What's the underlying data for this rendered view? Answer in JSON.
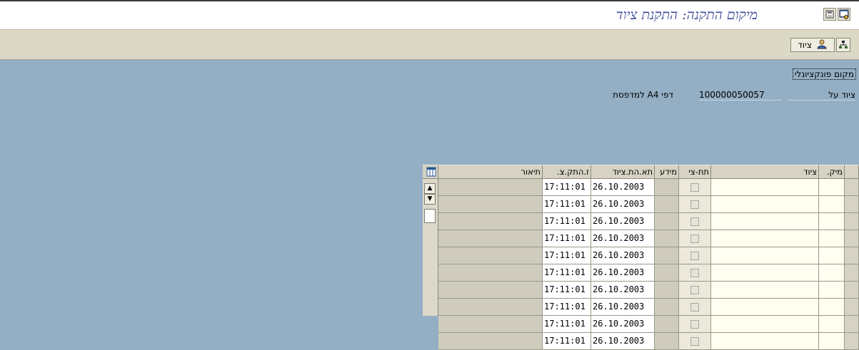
{
  "window": {
    "title": "מיקום התקנה: התקנת ציוד",
    "icons": [
      "save-icon",
      "layout-icon"
    ]
  },
  "toolbar": {
    "equipment_label": "ציוד",
    "icons": [
      "hierarchy-icon",
      "person-icon"
    ]
  },
  "header": {
    "functional_location_label": "מקום פונקציונלי",
    "equipment_on_label": "ציוד על",
    "equipment_number": "100000050057",
    "equipment_description": "דפי A4 למדפסת"
  },
  "table": {
    "columns": {
      "loc": "מיק.",
      "equipment": "ציוד",
      "sub_equipment": "תת-צי",
      "info": "מידע",
      "install_date": "תא.הת.ציוד",
      "install_time": "ז.התק.צ.",
      "description": "תיאור"
    },
    "rows": [
      {
        "date": "26.10.2003",
        "time": "17:11:01"
      },
      {
        "date": "26.10.2003",
        "time": "17:11:01"
      },
      {
        "date": "26.10.2003",
        "time": "17:11:01"
      },
      {
        "date": "26.10.2003",
        "time": "17:11:01"
      },
      {
        "date": "26.10.2003",
        "time": "17:11:01"
      },
      {
        "date": "26.10.2003",
        "time": "17:11:01"
      },
      {
        "date": "26.10.2003",
        "time": "17:11:01"
      },
      {
        "date": "26.10.2003",
        "time": "17:11:01"
      },
      {
        "date": "26.10.2003",
        "time": "17:11:01"
      },
      {
        "date": "26.10.2003",
        "time": "17:11:01"
      }
    ]
  },
  "colors": {
    "background": "#94afc4",
    "title": "#3d4a98",
    "toolbar": "#dcd8c6"
  }
}
